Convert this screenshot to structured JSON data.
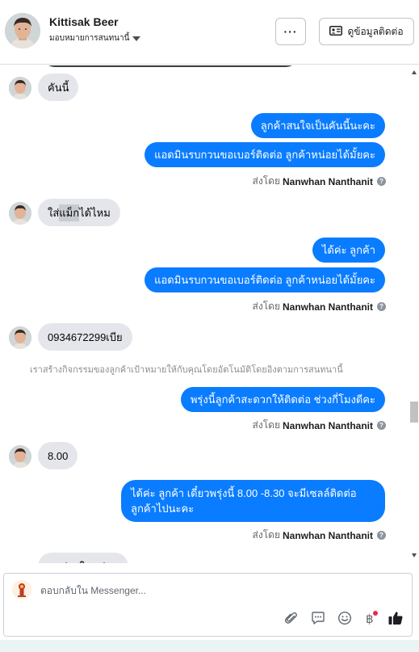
{
  "header": {
    "contact_name": "Kittisak Beer",
    "assign_label": "มอบหมายการสนทนานี้",
    "more_label": "···",
    "view_contact_label": "ดูข้อมูลติดต่อ"
  },
  "messages": [
    {
      "from": "customer",
      "text": "คันนี้"
    },
    {
      "from": "page",
      "text": "ลูกค้าสนใจเป็นคันนี้นะคะ"
    },
    {
      "from": "page",
      "text": "แอดมินรบกวนขอเบอร์ติดต่อ ลูกค้าหน่อยได้มั้ยคะ"
    },
    {
      "from": "customer",
      "text_parts": [
        "ใส่",
        "แม็ก",
        "ได้ไหม"
      ]
    },
    {
      "from": "page",
      "text": "ได้ค่ะ ลูกค้า"
    },
    {
      "from": "page",
      "text": "แอดมินรบกวนขอเบอร์ติดต่อ ลูกค้าหน่อยได้มั้ยคะ"
    },
    {
      "from": "customer",
      "text": "0934672299เบีย"
    },
    {
      "from": "system",
      "text": "เราสร้างกิจกรรมของลูกค้าเป้าหมายให้กับคุณโดยอัตโนมัติโดยอิงตามการสนทนานี้"
    },
    {
      "from": "page",
      "text": "พรุ่งนี้ลูกค้าสะดวกให้ติดต่อ ช่วงกี่โมงดีคะ"
    },
    {
      "from": "customer",
      "text": "8.00"
    },
    {
      "from": "page",
      "text": "ได้ค่ะ ลูกค้า เดี๋ยวพรุ่งนี้ 8.00 -8.30 จะมีเซลล์ติดต่อ ลูกค้าไปนะคะ"
    },
    {
      "from": "customer",
      "text": "ขอถ่ายในหน่อย"
    }
  ],
  "sent_by": {
    "prefix": "ส่งโดย",
    "name": "Nanwhan Nanthanit",
    "help_icon": "question-circle-icon"
  },
  "composer": {
    "placeholder": "ตอบกลับใน Messenger...",
    "icons": [
      "paperclip-icon",
      "saved-reply-icon",
      "emoji-icon",
      "baht-payment-icon",
      "thumbs-up-icon"
    ]
  },
  "colors": {
    "outgoing_bubble": "#0a7cff",
    "incoming_bubble": "#e4e6eb",
    "like_button": "#1c1e21",
    "notification_dot": "#f02849"
  }
}
